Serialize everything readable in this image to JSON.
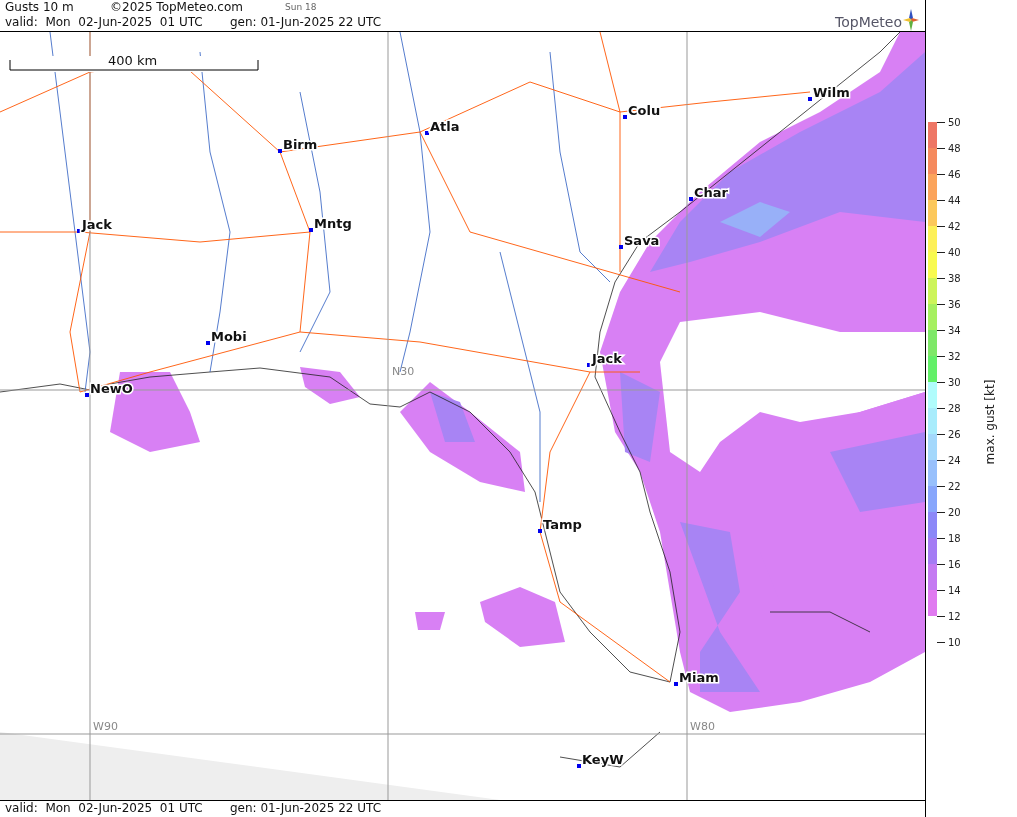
{
  "header": {
    "title": "Gusts 10 m",
    "copyright": "©2025 TopMeteo.com",
    "run": "Sun 18",
    "valid": "valid:  Mon  02-Jun-2025  01 UTC",
    "generated": "gen: 01-Jun-2025 22 UTC",
    "logo": "TopMeteo"
  },
  "map": {
    "scale": "400 km",
    "grid_labels": [
      "N30",
      "W90",
      "W80"
    ],
    "cities": [
      "Wilm",
      "Colu",
      "Atla",
      "Birm",
      "Char",
      "Jack",
      "Mntg",
      "Sava",
      "Mobi",
      "Jack",
      "NewO",
      "Tamp",
      "Miam",
      "KeyW"
    ]
  },
  "legend": {
    "title": "max. gust [kt]",
    "ticks": [
      "50",
      "48",
      "46",
      "44",
      "42",
      "40",
      "38",
      "36",
      "34",
      "32",
      "30",
      "28",
      "26",
      "24",
      "22",
      "20",
      "18",
      "16",
      "14",
      "12",
      "10"
    ],
    "bands": [
      {
        "color": "#ee7766"
      },
      {
        "color": "#f58a5e"
      },
      {
        "color": "#fba45c"
      },
      {
        "color": "#fcc85c"
      },
      {
        "color": "#fdf058"
      },
      {
        "color": "#f8fa50"
      },
      {
        "color": "#cdf45a"
      },
      {
        "color": "#a6f060"
      },
      {
        "color": "#7ee868"
      },
      {
        "color": "#62f068"
      },
      {
        "color": "#b0fcfc"
      },
      {
        "color": "#a8ecfc"
      },
      {
        "color": "#a4d8fc"
      },
      {
        "color": "#98c0fc"
      },
      {
        "color": "#88a6fc"
      },
      {
        "color": "#8c88f8"
      },
      {
        "color": "#a47cf4"
      },
      {
        "color": "#c47af2"
      },
      {
        "color": "#e07af0"
      }
    ]
  },
  "footer": {
    "valid": "valid:  Mon  02-Jun-2025  01 UTC",
    "generated": "gen: 01-Jun-2025 22 UTC"
  }
}
